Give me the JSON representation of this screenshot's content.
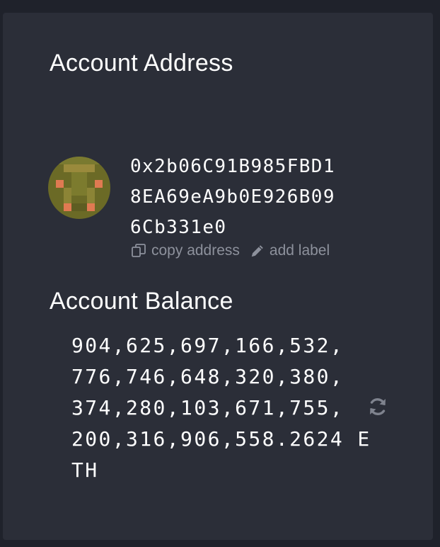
{
  "account": {
    "address_title": "Account Address",
    "address_lines": [
      "0x2b06C91B985FBD1",
      "8EA69eA9b0E926B09",
      "6Cb331e0"
    ],
    "actions": {
      "copy_label": "copy address",
      "label_label": "add label"
    },
    "balance_title": "Account Balance",
    "balance_lines": [
      "904,625,697,166,532,",
      "776,746,648,320,380,",
      "374,280,103,671,755,",
      "200,316,906,558.2624 E",
      "TH"
    ],
    "icons": {
      "avatar": "identicon-avatar",
      "copy": "copy-icon",
      "edit": "pencil-icon",
      "refresh": "refresh-icon"
    },
    "colors": {
      "background": "#1f222b",
      "panel": "#2b2e38",
      "text": "#ffffff",
      "muted": "#8d919c",
      "avatar_base": "#6b6a26",
      "avatar_accent": "#e07a52"
    }
  }
}
